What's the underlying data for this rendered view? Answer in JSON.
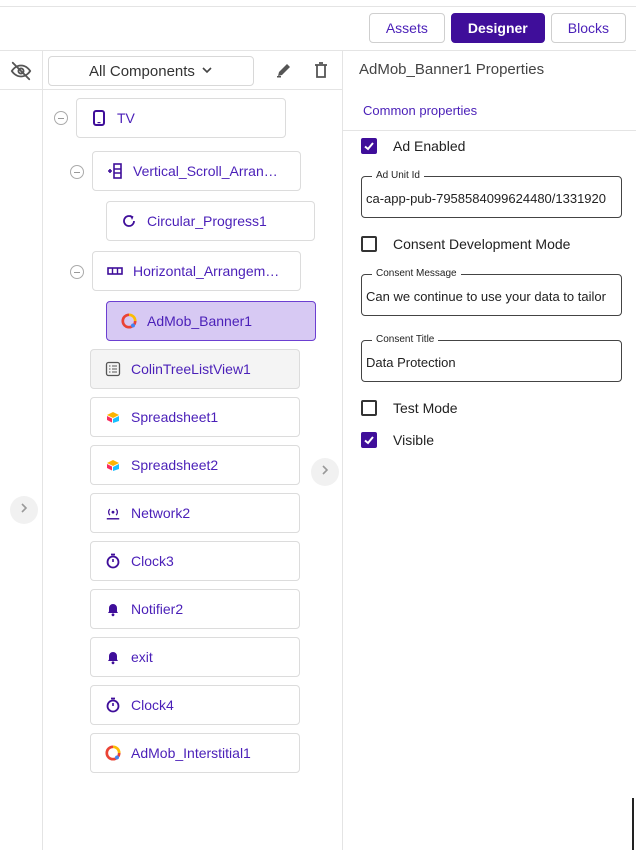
{
  "header": {
    "tabs": [
      {
        "label": "Assets",
        "active": false
      },
      {
        "label": "Designer",
        "active": true
      },
      {
        "label": "Blocks",
        "active": false
      }
    ]
  },
  "toolbar": {
    "filter_label": "All Components",
    "icons": [
      "eye-off-icon",
      "pencil-icon",
      "trash-icon",
      "chevron-down-icon"
    ]
  },
  "tree": {
    "nodes": [
      {
        "label": "TV",
        "icon": "phone-icon"
      },
      {
        "label": "Vertical_Scroll_Arran…",
        "icon": "vertical-scroll-icon"
      },
      {
        "label": "Circular_Progress1",
        "icon": "refresh-icon"
      },
      {
        "label": "Horizontal_Arrangem…",
        "icon": "horizontal-arrangement-icon"
      },
      {
        "label": "AdMob_Banner1",
        "icon": "admob-icon",
        "selected": true
      },
      {
        "label": "ColinTreeListView1",
        "icon": "list-icon"
      },
      {
        "label": "Spreadsheet1",
        "icon": "spreadsheet-icon"
      },
      {
        "label": "Spreadsheet2",
        "icon": "spreadsheet-icon"
      },
      {
        "label": "Network2",
        "icon": "network-icon"
      },
      {
        "label": "Clock3",
        "icon": "clock-icon"
      },
      {
        "label": "Notifier2",
        "icon": "bell-icon"
      },
      {
        "label": "exit",
        "icon": "bell-icon"
      },
      {
        "label": "Clock4",
        "icon": "clock-icon"
      },
      {
        "label": "AdMob_Interstitial1",
        "icon": "admob-icon"
      }
    ]
  },
  "properties": {
    "title": "AdMob_Banner1 Properties",
    "section": "Common properties",
    "ad_enabled": {
      "label": "Ad Enabled",
      "checked": true
    },
    "ad_unit_id": {
      "legend": "Ad Unit Id",
      "value": "ca-app-pub-7958584099624480/1331920"
    },
    "consent_dev_mode": {
      "label": "Consent Development Mode",
      "checked": false
    },
    "consent_message": {
      "legend": "Consent Message",
      "value": "Can we continue to use your data to tailor"
    },
    "consent_title": {
      "legend": "Consent Title",
      "value": "Data Protection"
    },
    "test_mode": {
      "label": "Test Mode",
      "checked": false
    },
    "visible": {
      "label": "Visible",
      "checked": true
    }
  },
  "colors": {
    "accent": "#3f0e9a",
    "link": "#4a1fb8",
    "selected_bg": "#d7c9f3"
  }
}
